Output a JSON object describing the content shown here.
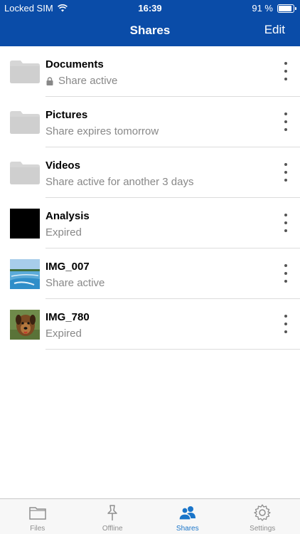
{
  "status": {
    "carrier": "Locked SIM",
    "time": "16:39",
    "battery": "91 %",
    "battery_level": 0.91
  },
  "navbar": {
    "title": "Shares",
    "edit_label": "Edit"
  },
  "items": [
    {
      "title": "Documents",
      "subtitle": "Share active",
      "type": "folder",
      "locked": true
    },
    {
      "title": "Pictures",
      "subtitle": "Share expires tomorrow",
      "type": "folder",
      "locked": false
    },
    {
      "title": "Videos",
      "subtitle": "Share active for another 3 days",
      "type": "folder",
      "locked": false
    },
    {
      "title": "Analysis",
      "subtitle": "Expired",
      "type": "black-thumbnail",
      "locked": false
    },
    {
      "title": "IMG_007",
      "subtitle": "Share active",
      "type": "beach-photo-thumbnail",
      "locked": false
    },
    {
      "title": "IMG_780",
      "subtitle": "Expired",
      "type": "dog-photo-thumbnail",
      "locked": false
    }
  ],
  "tabs": [
    {
      "label": "Files",
      "icon": "folder-icon",
      "active": false
    },
    {
      "label": "Offline",
      "icon": "pin-icon",
      "active": false
    },
    {
      "label": "Shares",
      "icon": "users-icon",
      "active": true
    },
    {
      "label": "Settings",
      "icon": "gear-icon",
      "active": false
    }
  ],
  "colors": {
    "accent": "#0a4ca8",
    "tab_active": "#1a75c9",
    "subtitle": "#888888"
  }
}
